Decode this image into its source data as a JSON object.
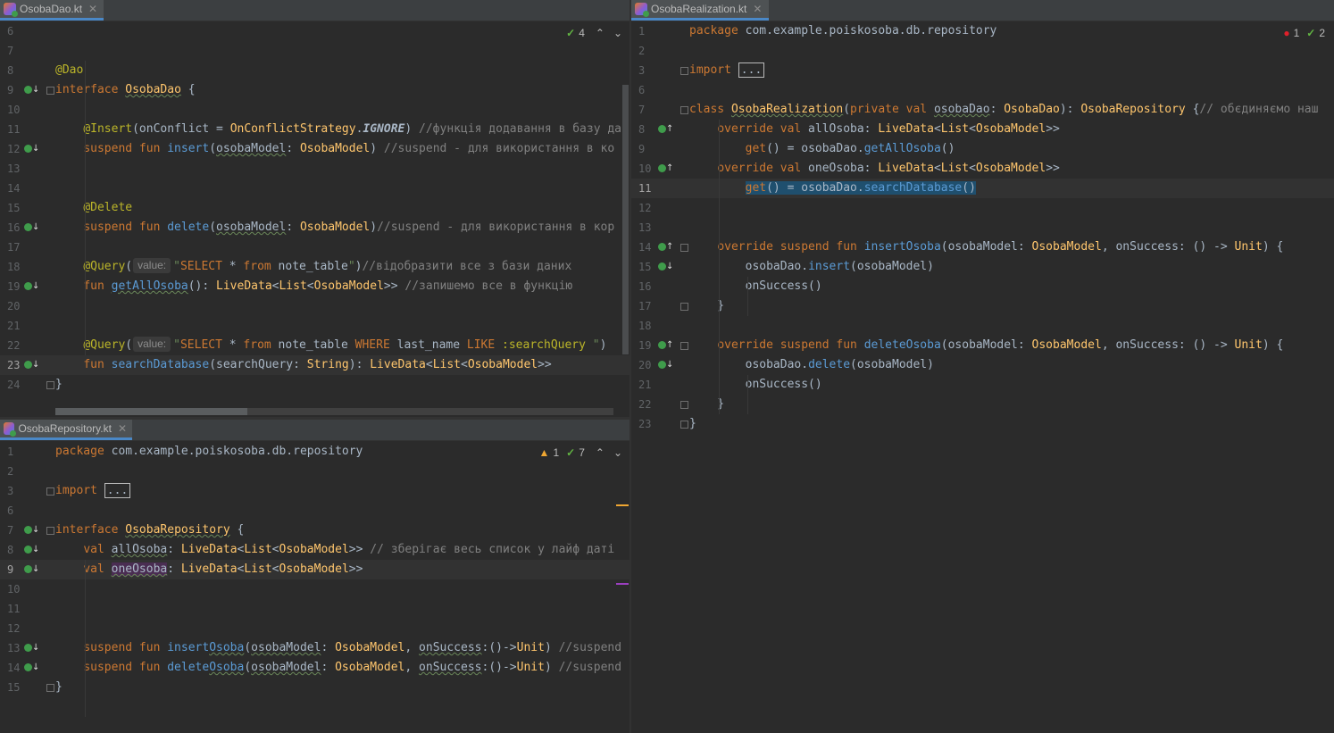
{
  "left_top": {
    "tab": "OsobaDao.kt",
    "status": {
      "checks": "4"
    },
    "lines": [
      {
        "n": "6",
        "html": ""
      },
      {
        "n": "7",
        "html": ""
      },
      {
        "n": "8",
        "html": "<span class='ann'>@Dao</span>"
      },
      {
        "n": "9",
        "html": "<span class='kw'>interface</span> <span class='cls squig'>OsobaDao</span> {"
      },
      {
        "n": "10",
        "html": ""
      },
      {
        "n": "11",
        "html": "    <span class='ann'>@Insert</span>(onConflict = <span class='cls'>OnConflictStrategy</span>.<span class='it'>IGNORE</span>) <span class='cm'>//функція додавання в базу да</span>"
      },
      {
        "n": "12",
        "html": "    <span class='kw'>suspend fun</span> <span class='mth'>insert</span>(<span class='squig'>osobaModel</span>: <span class='cls'>OsobaModel</span>) <span class='cm'>//suspend - для використання в ко</span>"
      },
      {
        "n": "13",
        "html": ""
      },
      {
        "n": "14",
        "html": ""
      },
      {
        "n": "15",
        "html": "    <span class='ann'>@Delete</span>"
      },
      {
        "n": "16",
        "html": "    <span class='kw'>suspend fun</span> <span class='mth'>delete</span>(<span class='squig'>osobaModel</span>: <span class='cls'>OsobaModel</span>)<span class='cm'>//suspend - для використання в кор</span>"
      },
      {
        "n": "17",
        "html": ""
      },
      {
        "n": "18",
        "html": "    <span class='ann'>@Query</span>(<span class='hint'>value:</span><span class='str'>\"</span><span class='kw'>SELECT</span> * <span class='kw'>from</span> note_table<span class='str'>\"</span>)<span class='cm'>//відобразити все з бази даних</span>"
      },
      {
        "n": "19",
        "html": "    <span class='kw'>fun</span> <span class='mth squig'>getAllOsoba</span>(): <span class='cls'>LiveData</span>&lt;<span class='cls'>List</span>&lt;<span class='cls'>OsobaModel</span>&gt;&gt; <span class='cm'>//запишемо все в функцію</span>"
      },
      {
        "n": "20",
        "html": ""
      },
      {
        "n": "21",
        "html": ""
      },
      {
        "n": "22",
        "html": "    <span class='ann'>@Query</span>(<span class='hint'>value:</span><span class='str'>\"</span><span class='kw'>SELECT</span> * <span class='kw'>from</span> note_table <span class='kw'>WHERE</span> last_name <span class='kw'>LIKE</span> <span class='ann'>:searchQuery</span> <span class='str'>\"</span>)"
      },
      {
        "n": "23",
        "html": "    <span class='kw'>fun</span> <span class='mth'>searchDatabase</span>(searchQuery: <span class='cls'>String</span>): <span class='cls'>LiveData</span>&lt;<span class='cls'>List</span>&lt;<span class='cls'>OsobaModel</span>&gt;&gt;",
        "cur": true
      },
      {
        "n": "24",
        "html": "}"
      }
    ]
  },
  "left_bottom": {
    "tab": "OsobaRepository.kt",
    "status": {
      "warnings": "1",
      "checks": "7"
    },
    "lines": [
      {
        "n": "1",
        "html": "<span class='kw'>package</span> com.example.poiskosoba.db.repository"
      },
      {
        "n": "2",
        "html": ""
      },
      {
        "n": "3",
        "html": "<span class='kw'>import</span> <span class='box'>...</span>"
      },
      {
        "n": "6",
        "html": ""
      },
      {
        "n": "7",
        "html": "<span class='kw'>interface</span> <span class='cls squig'>OsobaRepository</span> {"
      },
      {
        "n": "8",
        "html": "    <span class='kw'>val</span> <span class='squig'>allOsoba</span>: <span class='cls'>LiveData</span>&lt;<span class='cls'>List</span>&lt;<span class='cls'>OsobaModel</span>&gt;&gt; <span class='cm'>// зберігає весь список у лайф даті</span>"
      },
      {
        "n": "9",
        "html": "    <span class='kw'>val</span> <span style='background:#4a2d52' class='squig'>oneOsoba</span>: <span class='cls'>LiveData</span>&lt;<span class='cls'>List</span>&lt;<span class='cls'>OsobaModel</span>&gt;&gt;",
        "cur": true
      },
      {
        "n": "10",
        "html": ""
      },
      {
        "n": "11",
        "html": ""
      },
      {
        "n": "12",
        "html": ""
      },
      {
        "n": "13",
        "html": "    <span class='kw'>suspend fun</span> <span class='mth'>insert<span class='squig'>Osoba</span></span>(<span class='squig'>osobaModel</span>: <span class='cls'>OsobaModel</span>, <span class='squig'>onSuccess</span>:()-&gt;<span class='cls'>Unit</span>) <span class='cm'>//suspend</span>"
      },
      {
        "n": "14",
        "html": "    <span class='kw'>suspend fun</span> <span class='mth'>delete<span class='squig'>Osoba</span></span>(<span class='squig'>osobaModel</span>: <span class='cls'>OsobaModel</span>, <span class='squig'>onSuccess</span>:()-&gt;<span class='cls'>Unit</span>) <span class='cm'>//suspend</span>"
      },
      {
        "n": "15",
        "html": "}"
      }
    ]
  },
  "right": {
    "tab": "OsobaRealization.kt",
    "status": {
      "errors": "1",
      "checks": "2"
    },
    "lines": [
      {
        "n": "1",
        "html": "<span class='kw'>package</span> com.example.poiskosoba.db.repository"
      },
      {
        "n": "2",
        "html": ""
      },
      {
        "n": "3",
        "html": "<span class='kw'>import</span> <span class='box'>...</span>"
      },
      {
        "n": "6",
        "html": ""
      },
      {
        "n": "7",
        "html": "<span class='kw'>class</span> <span class='cls squig'>OsobaRealization</span>(<span class='kw'>private val</span> <span class='squig'>osobaDao</span>: <span class='cls'>OsobaDao</span>): <span class='cls'>OsobaRepository</span> {<span class='cm'>// обєдиняємо наш</span>"
      },
      {
        "n": "8",
        "html": "    <span class='kw'>override val</span> allOsoba: <span class='cls'>LiveData</span>&lt;<span class='cls'>List</span>&lt;<span class='cls'>OsobaModel</span>&gt;&gt;"
      },
      {
        "n": "9",
        "html": "        <span class='kw'>get</span>() = osobaDao.<span class='mth'>getAllOsoba</span>()"
      },
      {
        "n": "10",
        "html": "    <span class='kw'>override val</span> oneOsoba: <span class='cls'>LiveData</span>&lt;<span class='cls'>List</span>&lt;<span class='cls'>OsobaModel</span>&gt;&gt;"
      },
      {
        "n": "11",
        "html": "        <span class='hl-line'><span class='kw'>get</span>() = osobaDao.<span class='mth'>searchDatabase</span>()</span>",
        "cur": true
      },
      {
        "n": "12",
        "html": ""
      },
      {
        "n": "13",
        "html": ""
      },
      {
        "n": "14",
        "html": "    <span class='kw'>override suspend fun</span> <span class='mth'>insertOsoba</span>(osobaModel: <span class='cls'>OsobaModel</span>, onSuccess: () -&gt; <span class='cls'>Unit</span>) {"
      },
      {
        "n": "15",
        "html": "        osobaDao.<span class='mth'>insert</span>(osobaModel)"
      },
      {
        "n": "16",
        "html": "        onSuccess()"
      },
      {
        "n": "17",
        "html": "    }"
      },
      {
        "n": "18",
        "html": ""
      },
      {
        "n": "19",
        "html": "    <span class='kw'>override suspend fun</span> <span class='mth'>deleteOsoba</span>(osobaModel: <span class='cls'>OsobaModel</span>, onSuccess: () -&gt; <span class='cls'>Unit</span>) {"
      },
      {
        "n": "20",
        "html": "        osobaDao.<span class='mth'>delete</span>(osobaModel)"
      },
      {
        "n": "21",
        "html": "        onSuccess()"
      },
      {
        "n": "22",
        "html": "    }"
      },
      {
        "n": "23",
        "html": "}"
      }
    ]
  }
}
